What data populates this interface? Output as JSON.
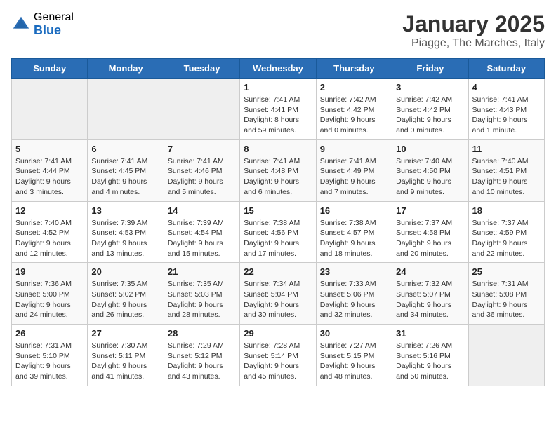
{
  "header": {
    "logo_general": "General",
    "logo_blue": "Blue",
    "title": "January 2025",
    "subtitle": "Piagge, The Marches, Italy"
  },
  "days_of_week": [
    "Sunday",
    "Monday",
    "Tuesday",
    "Wednesday",
    "Thursday",
    "Friday",
    "Saturday"
  ],
  "weeks": [
    [
      {
        "day": null
      },
      {
        "day": null
      },
      {
        "day": null
      },
      {
        "day": "1",
        "sunrise": "7:41 AM",
        "sunset": "4:41 PM",
        "daylight": "8 hours and 59 minutes."
      },
      {
        "day": "2",
        "sunrise": "7:42 AM",
        "sunset": "4:42 PM",
        "daylight": "9 hours and 0 minutes."
      },
      {
        "day": "3",
        "sunrise": "7:42 AM",
        "sunset": "4:42 PM",
        "daylight": "9 hours and 0 minutes."
      },
      {
        "day": "4",
        "sunrise": "7:41 AM",
        "sunset": "4:43 PM",
        "daylight": "9 hours and 1 minute."
      }
    ],
    [
      {
        "day": "5",
        "sunrise": "7:41 AM",
        "sunset": "4:44 PM",
        "daylight": "9 hours and 3 minutes."
      },
      {
        "day": "6",
        "sunrise": "7:41 AM",
        "sunset": "4:45 PM",
        "daylight": "9 hours and 4 minutes."
      },
      {
        "day": "7",
        "sunrise": "7:41 AM",
        "sunset": "4:46 PM",
        "daylight": "9 hours and 5 minutes."
      },
      {
        "day": "8",
        "sunrise": "7:41 AM",
        "sunset": "4:48 PM",
        "daylight": "9 hours and 6 minutes."
      },
      {
        "day": "9",
        "sunrise": "7:41 AM",
        "sunset": "4:49 PM",
        "daylight": "9 hours and 7 minutes."
      },
      {
        "day": "10",
        "sunrise": "7:40 AM",
        "sunset": "4:50 PM",
        "daylight": "9 hours and 9 minutes."
      },
      {
        "day": "11",
        "sunrise": "7:40 AM",
        "sunset": "4:51 PM",
        "daylight": "9 hours and 10 minutes."
      }
    ],
    [
      {
        "day": "12",
        "sunrise": "7:40 AM",
        "sunset": "4:52 PM",
        "daylight": "9 hours and 12 minutes."
      },
      {
        "day": "13",
        "sunrise": "7:39 AM",
        "sunset": "4:53 PM",
        "daylight": "9 hours and 13 minutes."
      },
      {
        "day": "14",
        "sunrise": "7:39 AM",
        "sunset": "4:54 PM",
        "daylight": "9 hours and 15 minutes."
      },
      {
        "day": "15",
        "sunrise": "7:38 AM",
        "sunset": "4:56 PM",
        "daylight": "9 hours and 17 minutes."
      },
      {
        "day": "16",
        "sunrise": "7:38 AM",
        "sunset": "4:57 PM",
        "daylight": "9 hours and 18 minutes."
      },
      {
        "day": "17",
        "sunrise": "7:37 AM",
        "sunset": "4:58 PM",
        "daylight": "9 hours and 20 minutes."
      },
      {
        "day": "18",
        "sunrise": "7:37 AM",
        "sunset": "4:59 PM",
        "daylight": "9 hours and 22 minutes."
      }
    ],
    [
      {
        "day": "19",
        "sunrise": "7:36 AM",
        "sunset": "5:00 PM",
        "daylight": "9 hours and 24 minutes."
      },
      {
        "day": "20",
        "sunrise": "7:35 AM",
        "sunset": "5:02 PM",
        "daylight": "9 hours and 26 minutes."
      },
      {
        "day": "21",
        "sunrise": "7:35 AM",
        "sunset": "5:03 PM",
        "daylight": "9 hours and 28 minutes."
      },
      {
        "day": "22",
        "sunrise": "7:34 AM",
        "sunset": "5:04 PM",
        "daylight": "9 hours and 30 minutes."
      },
      {
        "day": "23",
        "sunrise": "7:33 AM",
        "sunset": "5:06 PM",
        "daylight": "9 hours and 32 minutes."
      },
      {
        "day": "24",
        "sunrise": "7:32 AM",
        "sunset": "5:07 PM",
        "daylight": "9 hours and 34 minutes."
      },
      {
        "day": "25",
        "sunrise": "7:31 AM",
        "sunset": "5:08 PM",
        "daylight": "9 hours and 36 minutes."
      }
    ],
    [
      {
        "day": "26",
        "sunrise": "7:31 AM",
        "sunset": "5:10 PM",
        "daylight": "9 hours and 39 minutes."
      },
      {
        "day": "27",
        "sunrise": "7:30 AM",
        "sunset": "5:11 PM",
        "daylight": "9 hours and 41 minutes."
      },
      {
        "day": "28",
        "sunrise": "7:29 AM",
        "sunset": "5:12 PM",
        "daylight": "9 hours and 43 minutes."
      },
      {
        "day": "29",
        "sunrise": "7:28 AM",
        "sunset": "5:14 PM",
        "daylight": "9 hours and 45 minutes."
      },
      {
        "day": "30",
        "sunrise": "7:27 AM",
        "sunset": "5:15 PM",
        "daylight": "9 hours and 48 minutes."
      },
      {
        "day": "31",
        "sunrise": "7:26 AM",
        "sunset": "5:16 PM",
        "daylight": "9 hours and 50 minutes."
      },
      {
        "day": null
      }
    ]
  ],
  "labels": {
    "sunrise_prefix": "Sunrise: ",
    "sunset_prefix": "Sunset: ",
    "daylight_prefix": "Daylight: "
  }
}
